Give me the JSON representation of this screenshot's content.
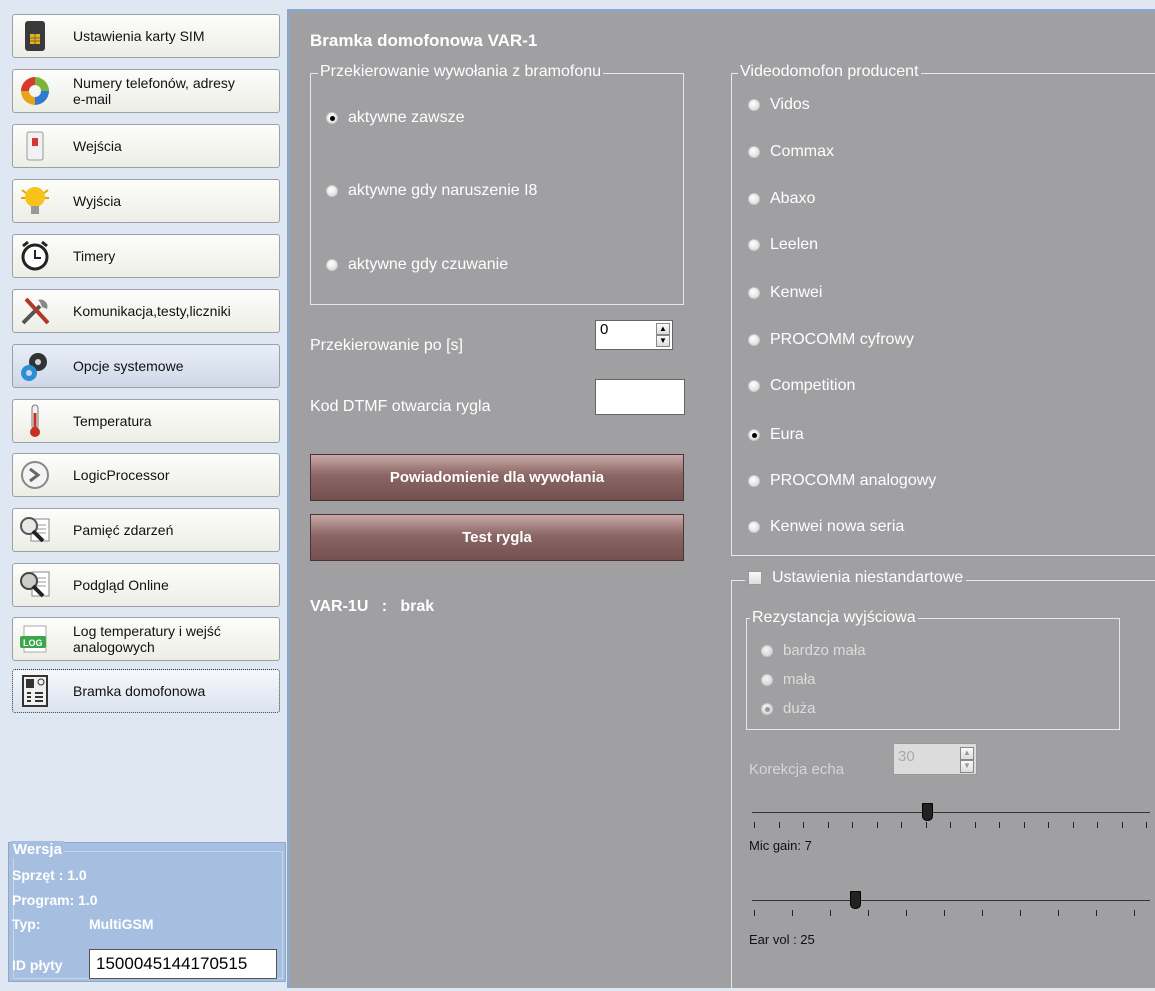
{
  "sidebar": {
    "items": [
      {
        "label": "Ustawienia karty SIM",
        "icon": "sim-card-icon"
      },
      {
        "label": "Numery telefonów, adresy\ne-mail",
        "icon": "contacts-circle-icon"
      },
      {
        "label": "Wejścia",
        "icon": "motion-sensor-icon"
      },
      {
        "label": "Wyjścia",
        "icon": "light-bulb-icon"
      },
      {
        "label": "Timery",
        "icon": "alarm-clock-icon"
      },
      {
        "label": "Komunikacja,testy,liczniki",
        "icon": "tools-icon"
      },
      {
        "label": "Opcje systemowe",
        "icon": "gears-icon"
      },
      {
        "label": "Temperatura",
        "icon": "thermometer-icon"
      },
      {
        "label": "LogicProcessor",
        "icon": "logic-processor-icon"
      },
      {
        "label": "Pamięć zdarzeń",
        "icon": "event-memory-icon"
      },
      {
        "label": "Podgląd Online",
        "icon": "online-preview-icon"
      },
      {
        "label": "Log temperatury i wejść\nanalogowych",
        "icon": "log-icon"
      },
      {
        "label": "Bramka domofonowa",
        "icon": "intercom-icon"
      }
    ]
  },
  "version": {
    "legend": "Wersja",
    "hardware": "Sprzęt :  1.0",
    "program": "Program: 1.0",
    "type_label": "Typ:",
    "type_value": "MultiGSM",
    "id_label": "ID płyty",
    "id_value": "1500045144170515"
  },
  "main": {
    "title": "Bramka domofonowa VAR-1",
    "forwarding": {
      "legend": "Przekierowanie wywołania z bramofonu",
      "options": [
        "aktywne zawsze",
        "aktywne gdy naruszenie I8",
        "aktywne gdy czuwanie"
      ],
      "selected": 0
    },
    "forward_after_label": "Przekierowanie po [s]",
    "forward_after_value": "0",
    "dtmf_label": "Kod DTMF otwarcia rygla",
    "dtmf_value": "",
    "notify_button": "Powiadomienie dla wywołania",
    "test_button": "Test rygla",
    "var_status": "VAR-1U   :   brak",
    "manufacturer": {
      "legend": "Videodomofon producent",
      "options": [
        "Vidos",
        "Commax",
        "Abaxo",
        "Leelen",
        "Kenwei",
        "PROCOMM cyfrowy",
        "Competition",
        "Eura",
        "PROCOMM analogowy",
        "Kenwei nowa seria"
      ],
      "selected": 7
    },
    "custom": {
      "legend": "Ustawienia niestandartowe",
      "checked": false,
      "resistance_legend": "Rezystancja wyjściowa",
      "resistance_options": [
        "bardzo mała",
        "mała",
        "duża"
      ],
      "resistance_selected": 2,
      "echo_label": "Korekcja echa",
      "echo_value": "30",
      "mic_gain_label": "Mic gain: 7",
      "mic_gain_fraction": 0.44,
      "ear_vol_label": "Ear vol : 25",
      "ear_vol_fraction": 0.26
    }
  }
}
